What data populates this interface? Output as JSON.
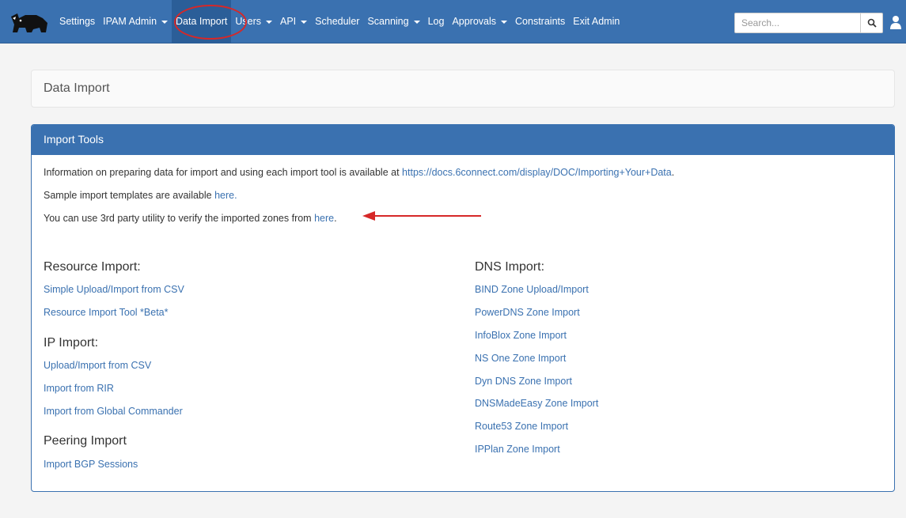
{
  "nav": {
    "items": [
      {
        "label": "Settings",
        "has_caret": false
      },
      {
        "label": "IPAM Admin",
        "has_caret": true
      },
      {
        "label": "Data Import",
        "has_caret": false,
        "active": true
      },
      {
        "label": "Users",
        "has_caret": true
      },
      {
        "label": "API",
        "has_caret": true
      },
      {
        "label": "Scheduler",
        "has_caret": false
      },
      {
        "label": "Scanning",
        "has_caret": true
      },
      {
        "label": "Log",
        "has_caret": false
      },
      {
        "label": "Approvals",
        "has_caret": true
      },
      {
        "label": "Constraints",
        "has_caret": false
      },
      {
        "label": "Exit Admin",
        "has_caret": false
      }
    ],
    "search_placeholder": "Search...",
    "colors": {
      "navbar": "#3a71b0",
      "highlight": "#d62828"
    }
  },
  "page": {
    "title": "Data Import"
  },
  "panel": {
    "heading": "Import Tools",
    "info": {
      "line1_prefix": "Information on preparing data for import and using each import tool is available at ",
      "line1_link": "https://docs.6connect.com/display/DOC/Importing+Your+Data",
      "line1_suffix": ".",
      "line2_prefix": "Sample import templates are available ",
      "line2_link": "here.",
      "line3_prefix": "You can use 3rd party utility to verify the imported zones from ",
      "line3_link": "here",
      "line3_suffix": "."
    },
    "resource_import": {
      "title": "Resource Import:",
      "links": [
        "Simple Upload/Import from CSV",
        "Resource Import Tool *Beta*"
      ]
    },
    "ip_import": {
      "title": "IP Import:",
      "links": [
        "Upload/Import from CSV",
        "Import from RIR",
        "Import from Global Commander"
      ]
    },
    "peering_import": {
      "title": "Peering Import",
      "links": [
        "Import BGP Sessions"
      ]
    },
    "dns_import": {
      "title": "DNS Import:",
      "links": [
        "BIND Zone Upload/Import",
        "PowerDNS Zone Import",
        "InfoBlox Zone Import",
        "NS One Zone Import",
        "Dyn DNS Zone Import",
        "DNSMadeEasy Zone Import",
        "Route53 Zone Import",
        "IPPlan Zone Import"
      ]
    }
  }
}
